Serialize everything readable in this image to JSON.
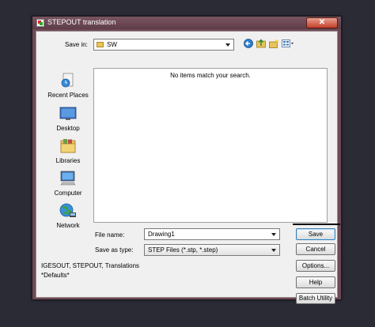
{
  "window": {
    "title": "STEPOUT translation",
    "close_glyph": "✕"
  },
  "toolbar": {
    "save_in_label": "Save in:",
    "save_in_value": "SW",
    "icons": [
      "back-icon",
      "up-folder-icon",
      "new-folder-icon",
      "view-menu-icon"
    ]
  },
  "sidebar": {
    "items": [
      {
        "label": "Recent Places",
        "icon": "recent-places-icon"
      },
      {
        "label": "Desktop",
        "icon": "desktop-icon"
      },
      {
        "label": "Libraries",
        "icon": "libraries-icon"
      },
      {
        "label": "Computer",
        "icon": "computer-icon"
      },
      {
        "label": "Network",
        "icon": "network-icon"
      }
    ]
  },
  "file_list": {
    "empty_message": "No items match your search."
  },
  "form": {
    "file_name_label": "File name:",
    "file_name_value": "Drawing1",
    "save_as_type_label": "Save as type:",
    "save_as_type_value": "STEP Files (*.stp, *.step)"
  },
  "info": {
    "line1": "IGESOUT, STEPOUT,  Translations",
    "line2": "*Defaults*"
  },
  "buttons": {
    "save": "Save",
    "cancel": "Cancel",
    "options": "Options...",
    "help": "Help",
    "batch": "Batch Utility"
  },
  "colors": {
    "titlebar": "#6e4a55",
    "dialog_bg": "#f0f0f0",
    "default_button_border": "#3c7fb1"
  }
}
